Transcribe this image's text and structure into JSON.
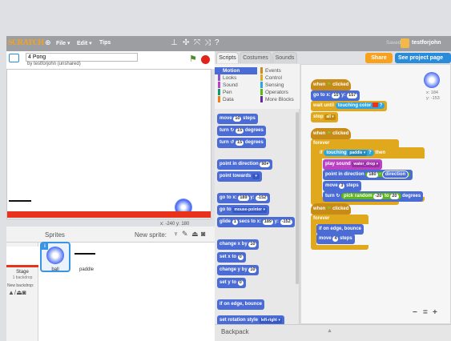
{
  "menubar": {
    "logo": "SCRATCH",
    "file": "File ▾",
    "edit": "Edit ▾",
    "tips": "Tips",
    "saved": "Saved",
    "user": "testforjohn"
  },
  "project": {
    "title_value": "4 Pong",
    "by": "by testforjohn (unshared)"
  },
  "stage": {
    "x_readout": "x: -240  y: 180"
  },
  "sprites": {
    "header": "Sprites",
    "new_sprite": "New sprite:",
    "stage_label": "Stage",
    "backdrop_count": "1 backdrop",
    "new_backdrop": "New backdrop:",
    "items": [
      {
        "name": "ball"
      },
      {
        "name": "paddle"
      }
    ]
  },
  "tabs": {
    "scripts": "Scripts",
    "costumes": "Costumes",
    "sounds": "Sounds"
  },
  "header_buttons": {
    "share": "Share",
    "see_page": "See project page"
  },
  "categories": [
    {
      "label": "Motion",
      "color": "#4a6cd4"
    },
    {
      "label": "Events",
      "color": "#c88b18"
    },
    {
      "label": "Looks",
      "color": "#8a55d7"
    },
    {
      "label": "Control",
      "color": "#e0a81c"
    },
    {
      "label": "Sound",
      "color": "#bb42c3"
    },
    {
      "label": "Sensing",
      "color": "#2ca5e2"
    },
    {
      "label": "Pen",
      "color": "#0e9a6c"
    },
    {
      "label": "Operators",
      "color": "#5cb712"
    },
    {
      "label": "Data",
      "color": "#ee7d16"
    },
    {
      "label": "More Blocks",
      "color": "#632d99"
    }
  ],
  "palette": {
    "move": "move",
    "move_val": "10",
    "steps": "steps",
    "turn_cw": "turn",
    "turn_cw_val": "15",
    "degrees": "degrees",
    "turn_ccw": "turn",
    "turn_ccw_val": "15",
    "point_dir": "point in direction",
    "point_dir_val": "90▾",
    "point_towards": "point towards",
    "goto_xy": "go to x:",
    "goto_x": "189",
    "goto_y_lbl": "y:",
    "goto_y": "-152",
    "goto": "go to",
    "goto_sel": "mouse-pointer ▾",
    "glide": "glide",
    "glide_secs": "1",
    "glide_secs_lbl": "secs to x:",
    "glide_x": "189",
    "glide_y_lbl": "y:",
    "glide_y": "-152",
    "change_x": "change x by",
    "change_x_val": "10",
    "set_x": "set x to",
    "set_x_val": "0",
    "change_y": "change y by",
    "change_y_val": "10",
    "set_y": "set y to",
    "set_y_val": "0",
    "bounce": "if on edge, bounce",
    "rotation": "set rotation style",
    "rotation_sel": "left-right ▾"
  },
  "scripts": {
    "xy_readout_x": "x: 184",
    "xy_readout_y": "y: -153",
    "s1_when": "when",
    "s1_clicked": "clicked",
    "s1_goto": "go to x:",
    "s1_goto_x": "15",
    "s1_goto_y_lbl": "y:",
    "s1_goto_y": "157",
    "s1_wait": "wait until",
    "s1_touching": "touching color",
    "s1_q": "?",
    "s1_stop": "stop",
    "s1_stop_sel": "all ▾",
    "s2_when": "when",
    "s2_clicked": "clicked",
    "s2_forever": "forever",
    "s2_if": "if",
    "s2_touching": "touching",
    "s2_touching_sel": "paddle ▾",
    "s2_q": "?",
    "s2_then": "then",
    "s2_play": "play sound",
    "s2_play_sel": "water_drop ▾",
    "s2_point": "point in direction",
    "s2_point_val": "180",
    "s2_minus": "-",
    "s2_direction": "direction",
    "s2_move": "move",
    "s2_move_val": "3",
    "s2_steps": "steps",
    "s2_turn": "turn",
    "s2_pick": "pick random",
    "s2_pick_a": "-20",
    "s2_to": "to",
    "s2_pick_b": "20",
    "s2_degrees": "degrees",
    "s3_when": "when",
    "s3_clicked": "clicked",
    "s3_forever": "forever",
    "s3_bounce": "if on edge, bounce",
    "s3_move": "move",
    "s3_move_val": "4",
    "s3_steps": "steps"
  },
  "backpack": "Backpack",
  "zoom": {
    "minus": "−",
    "reset": "=",
    "plus": "+"
  }
}
